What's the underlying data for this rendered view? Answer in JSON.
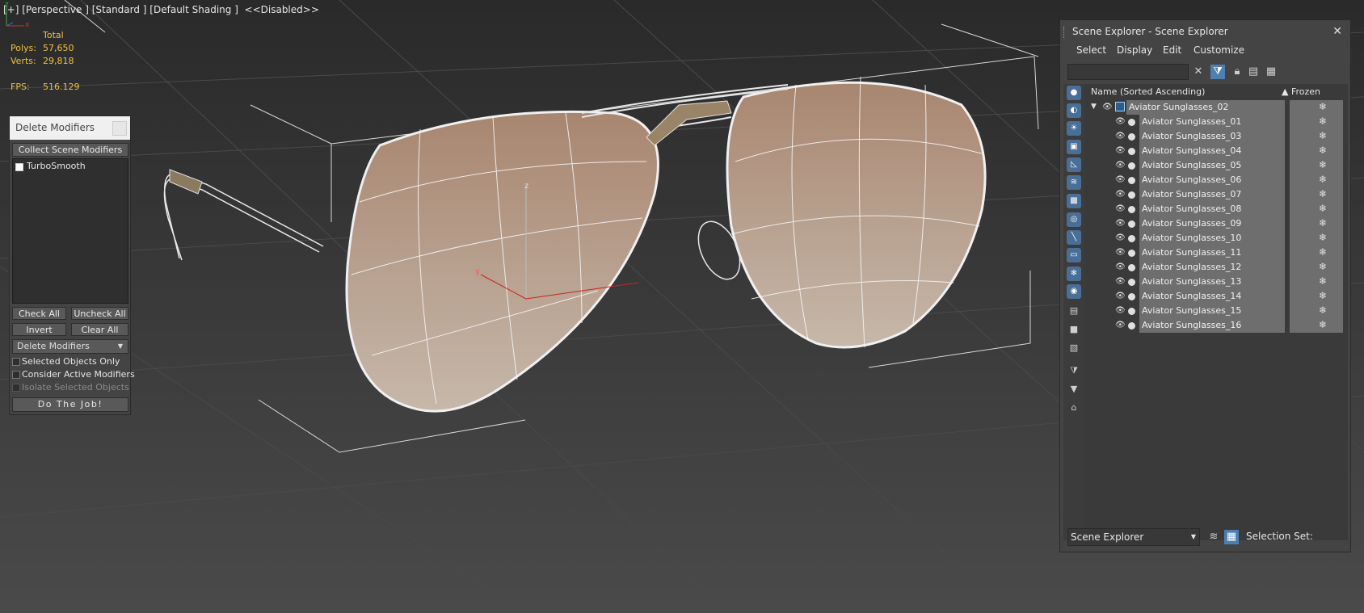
{
  "viewport": {
    "label": "[+] [Perspective ] [Standard ] [Default Shading ]  <<Disabled>>",
    "stats": {
      "header": "Total",
      "polys_label": "Polys:",
      "polys_value": "57,650",
      "verts_label": "Verts:",
      "verts_value": "29,818",
      "fps_label": "FPS:",
      "fps_value": "516.129"
    },
    "gizmo_labels": {
      "z": "z",
      "y": "y"
    },
    "tripod": {
      "z": "z",
      "x": "x"
    }
  },
  "delete_modifiers": {
    "title": "Delete Modifiers",
    "collect_button": "Collect Scene Modifiers",
    "modifiers": [
      "TurboSmooth"
    ],
    "check_all": "Check All",
    "uncheck_all": "Uncheck All",
    "invert": "Invert",
    "clear_all": "Clear All",
    "mode_select": "Delete Modifiers",
    "selected_only": "Selected Objects Only",
    "consider_active": "Consider Active Modifiers",
    "isolate_selected": "Isolate Selected Objects",
    "do_job": "Do The Job!"
  },
  "scene_explorer": {
    "title": "Scene Explorer - Scene Explorer",
    "menu": [
      "Select",
      "Display",
      "Edit",
      "Customize"
    ],
    "search_value": "",
    "columns": {
      "name": "Name (Sorted Ascending)",
      "frozen": "▲ Frozen"
    },
    "parent": "Aviator Sunglasses_02",
    "children": [
      "Aviator Sunglasses_01",
      "Aviator Sunglasses_03",
      "Aviator Sunglasses_04",
      "Aviator Sunglasses_05",
      "Aviator Sunglasses_06",
      "Aviator Sunglasses_07",
      "Aviator Sunglasses_08",
      "Aviator Sunglasses_09",
      "Aviator Sunglasses_10",
      "Aviator Sunglasses_11",
      "Aviator Sunglasses_12",
      "Aviator Sunglasses_13",
      "Aviator Sunglasses_14",
      "Aviator Sunglasses_15",
      "Aviator Sunglasses_16"
    ],
    "mode": "Scene Explorer",
    "selection_set_label": "Selection Set:"
  },
  "colors": {
    "viewport_bg": "#3b3b3b",
    "lens_top": "#a88670",
    "lens_bottom": "#c6b8aa",
    "stats_yellow": "#f0c040",
    "active_icon": "#4f7fb0"
  }
}
